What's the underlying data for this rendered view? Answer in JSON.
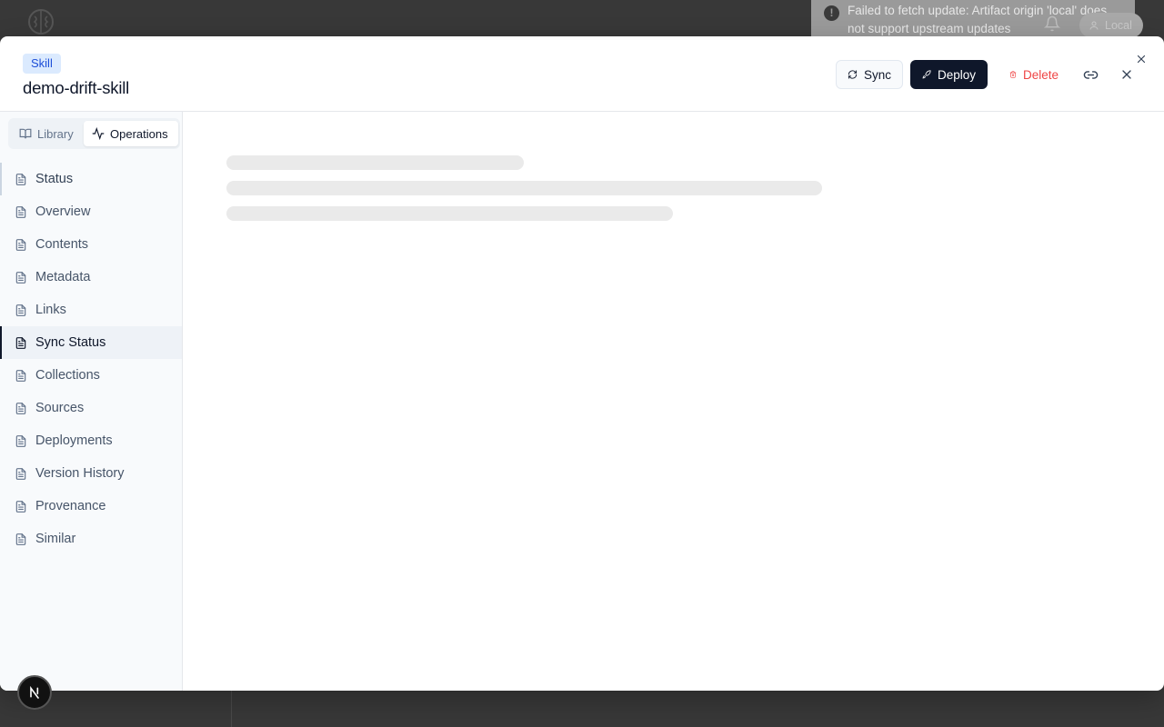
{
  "toast": {
    "message": "Failed to fetch update: Artifact origin 'local' does not support upstream updates"
  },
  "topbar": {
    "environment_label": "Local"
  },
  "modal": {
    "type_badge": "Skill",
    "title": "demo-drift-skill",
    "actions": {
      "sync_label": "Sync",
      "deploy_label": "Deploy",
      "delete_label": "Delete"
    }
  },
  "sidebar": {
    "tabs": [
      {
        "label": "Library",
        "icon": "book-open-icon",
        "selected": false
      },
      {
        "label": "Operations",
        "icon": "activity-icon",
        "selected": true
      }
    ],
    "items": [
      {
        "label": "Status"
      },
      {
        "label": "Overview"
      },
      {
        "label": "Contents"
      },
      {
        "label": "Metadata"
      },
      {
        "label": "Links"
      },
      {
        "label": "Sync Status",
        "active": true
      },
      {
        "label": "Collections"
      },
      {
        "label": "Sources"
      },
      {
        "label": "Deployments"
      },
      {
        "label": "Version History"
      },
      {
        "label": "Provenance"
      },
      {
        "label": "Similar"
      }
    ]
  },
  "colors": {
    "primary": "#0f172a",
    "danger": "#ef4444",
    "badge_bg": "#dbeafe",
    "badge_text": "#1d4ed8"
  }
}
